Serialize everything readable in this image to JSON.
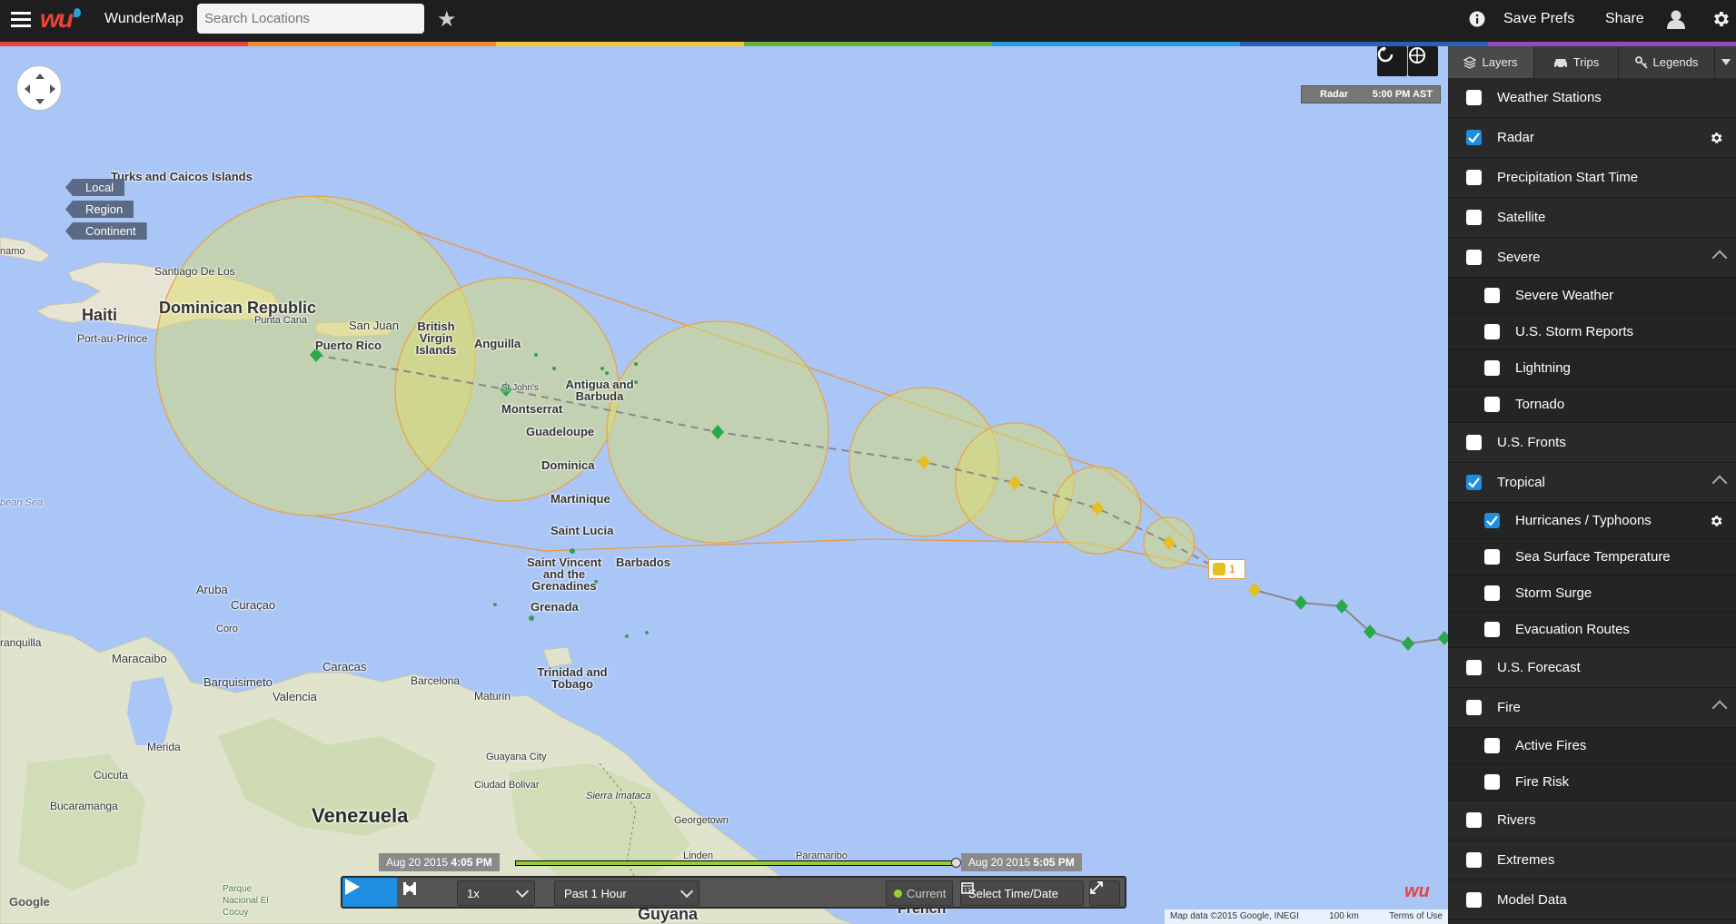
{
  "topbar": {
    "logo_text": "wu",
    "app_name": "WunderMap",
    "search_placeholder": "Search Locations",
    "save_prefs": "Save Prefs",
    "share": "Share"
  },
  "rainbow_colors": [
    "#e8423c",
    "#f28a2f",
    "#f4c531",
    "#6ab23e",
    "#2b9ed8",
    "#2a5fb5",
    "#8e4cc2"
  ],
  "map": {
    "scale_buttons": [
      "Local",
      "Region",
      "Continent"
    ],
    "radar_label": "Radar",
    "radar_time": "5:00 PM AST",
    "storm_badge": "1",
    "labels": {
      "turks": "Turks and Caicos Islands",
      "dominican": "Dominican Republic",
      "haiti": "Haiti",
      "santiago": "Santiago De Los",
      "port": "Port-au-Prince",
      "puntacana": "Punta Cana",
      "sanjuan": "San Juan",
      "puertorico": "Puerto Rico",
      "bvi": "British Virgin Islands",
      "anguilla": "Anguilla",
      "stjohns": "St John's",
      "antigua": "Antigua and Barbuda",
      "montserrat": "Montserrat",
      "guadeloupe": "Guadeloupe",
      "dominica": "Dominica",
      "martinique": "Martinique",
      "stlucia": "Saint Lucia",
      "stvincent": "Saint Vincent and the Grenadines",
      "barbados": "Barbados",
      "grenada": "Grenada",
      "aruba": "Aruba",
      "curacao": "Curaçao",
      "coro": "Coro",
      "maracaibo": "Maracaibo",
      "barquisimeto": "Barquisimeto",
      "caracas": "Caracas",
      "valencia": "Valencia",
      "barcelona": "Barcelona",
      "maturin": "Maturin",
      "trinidad": "Trinidad and Tobago",
      "merida": "Merida",
      "cucuta": "Cucuta",
      "bucaramanga": "Bucaramanga",
      "venezuela": "Venezuela",
      "guayana": "Guayana City",
      "bolivar": "Ciudad Bolivar",
      "sierra": "Sierra Imataca",
      "georgetown": "Georgetown",
      "linden": "Linden",
      "paramaribo": "Paramaribo",
      "guyana": "Guyana",
      "french": "French",
      "parque": "Parque Nacional El Cocuy",
      "sea": "bean Sea",
      "namo": "namo",
      "ranquilla": "ranquilla"
    }
  },
  "timeline": {
    "start_date": "Aug 20 2015",
    "start_time": "4:05 PM",
    "end_date": "Aug 20 2015",
    "end_time": "5:05 PM",
    "progress": 1.0
  },
  "player": {
    "speed": "1x",
    "range": "Past 1 Hour",
    "current": "Current",
    "select": "Select Time/Date"
  },
  "attribution": {
    "mapdata": "Map data ©2015 Google, INEGI",
    "scale": "100 km",
    "terms": "Terms of Use"
  },
  "panel": {
    "tabs": [
      "Layers",
      "Trips",
      "Legends"
    ],
    "items": [
      {
        "label": "Weather Stations",
        "checked": false,
        "sub": false
      },
      {
        "label": "Radar",
        "checked": true,
        "sub": false,
        "gear": true
      },
      {
        "label": "Precipitation Start Time",
        "checked": false,
        "sub": false
      },
      {
        "label": "Satellite",
        "checked": false,
        "sub": false
      },
      {
        "label": "Severe",
        "checked": false,
        "sub": false,
        "caret": true
      },
      {
        "label": "Severe Weather",
        "checked": false,
        "sub": true
      },
      {
        "label": "U.S. Storm Reports",
        "checked": false,
        "sub": true
      },
      {
        "label": "Lightning",
        "checked": false,
        "sub": true
      },
      {
        "label": "Tornado",
        "checked": false,
        "sub": true
      },
      {
        "label": "U.S. Fronts",
        "checked": false,
        "sub": false
      },
      {
        "label": "Tropical",
        "checked": true,
        "sub": false,
        "caret": true
      },
      {
        "label": "Hurricanes / Typhoons",
        "checked": true,
        "sub": true,
        "gear": true
      },
      {
        "label": "Sea Surface Temperature",
        "checked": false,
        "sub": true
      },
      {
        "label": "Storm Surge",
        "checked": false,
        "sub": true
      },
      {
        "label": "Evacuation Routes",
        "checked": false,
        "sub": true
      },
      {
        "label": "U.S. Forecast",
        "checked": false,
        "sub": false
      },
      {
        "label": "Fire",
        "checked": false,
        "sub": false,
        "caret": true
      },
      {
        "label": "Active Fires",
        "checked": false,
        "sub": true
      },
      {
        "label": "Fire Risk",
        "checked": false,
        "sub": true
      },
      {
        "label": "Rivers",
        "checked": false,
        "sub": false
      },
      {
        "label": "Extremes",
        "checked": false,
        "sub": false
      },
      {
        "label": "Model Data",
        "checked": false,
        "sub": false
      }
    ]
  }
}
